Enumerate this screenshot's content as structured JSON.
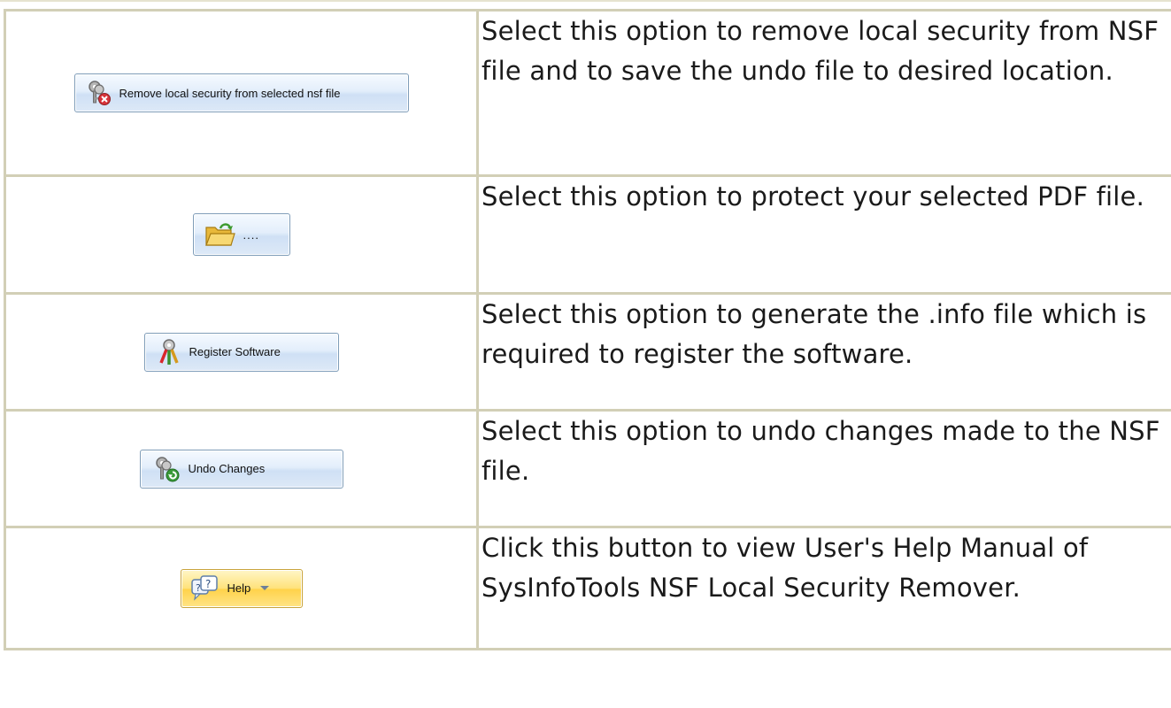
{
  "rows": [
    {
      "button": {
        "label": "Remove local security from selected nsf file",
        "icon": "keys-remove-icon"
      },
      "description": "Select this option to remove local security from NSF file and to save the undo file to desired location."
    },
    {
      "button": {
        "label": "....",
        "icon": "open-folder-icon"
      },
      "description": "Select this option to protect your selected PDF file."
    },
    {
      "button": {
        "label": "Register Software",
        "icon": "register-keys-icon"
      },
      "description": "Select this option to generate the .info file which is required to register the software."
    },
    {
      "button": {
        "label": "Undo Changes",
        "icon": "keys-undo-icon"
      },
      "description": "Select this option to undo changes made to the NSF file."
    },
    {
      "button": {
        "label": "Help",
        "icon": "help-bubble-icon",
        "dropdown_icon": "chevron-down-icon"
      },
      "description": "Click this button to view User's Help Manual of SysInfoTools NSF Local Security Remover."
    }
  ],
  "colors": {
    "border": "#d2cfb6",
    "button_blue": "#dde9f7",
    "button_help": "#ffd24a"
  }
}
